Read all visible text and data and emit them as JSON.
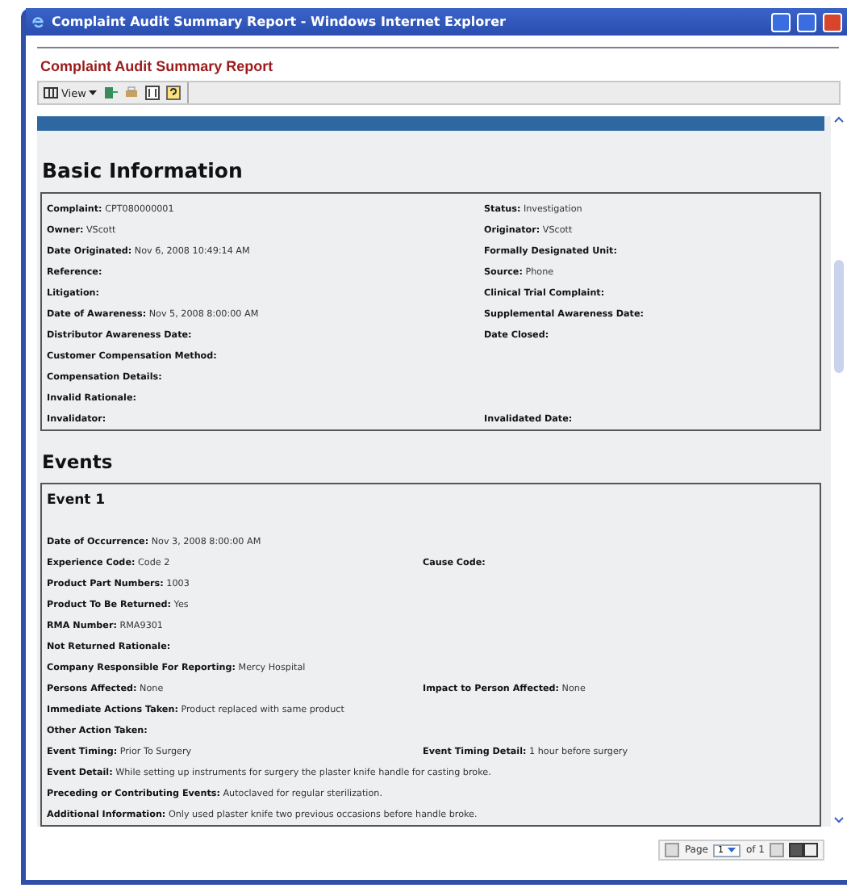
{
  "window": {
    "title": "Complaint Audit Summary Report - Windows Internet Explorer"
  },
  "report": {
    "title": "Complaint Audit Summary Report"
  },
  "toolbar": {
    "view_label": "View"
  },
  "basic": {
    "heading": "Basic Information",
    "rows": [
      {
        "left": {
          "label": "Complaint:",
          "value": "CPT080000001"
        },
        "right": {
          "label": "Status:",
          "value": "Investigation"
        }
      },
      {
        "left": {
          "label": "Owner:",
          "value": "VScott"
        },
        "right": {
          "label": "Originator:",
          "value": "VScott"
        }
      },
      {
        "left": {
          "label": "Date Originated:",
          "value": "Nov 6, 2008 10:49:14 AM"
        },
        "right": {
          "label": "Formally Designated Unit:"
        }
      },
      {
        "left": {
          "label": "Reference:"
        },
        "right": {
          "label": "Source:",
          "value": "Phone"
        }
      },
      {
        "left": {
          "label": "Litigation:"
        },
        "right": {
          "label": "Clinical Trial Complaint:"
        }
      },
      {
        "left": {
          "label": "Date of Awareness:",
          "value": "Nov 5, 2008 8:00:00 AM"
        },
        "right": {
          "label": "Supplemental Awareness Date:"
        }
      },
      {
        "left": {
          "label": "Distributor Awareness Date:"
        },
        "right": {
          "label": "Date Closed:"
        }
      },
      {
        "left": {
          "label": "Customer Compensation Method:"
        }
      },
      {
        "left": {
          "label": "Compensation Details:"
        }
      },
      {
        "left": {
          "label": "Invalid Rationale:"
        }
      },
      {
        "left": {
          "label": "Invalidator:"
        },
        "right": {
          "label": "Invalidated Date:"
        }
      }
    ]
  },
  "events": {
    "heading": "Events",
    "items": [
      {
        "title": "Event 1",
        "rows": [
          {
            "left": {
              "label": "Date of Occurrence:",
              "value": "Nov 3, 2008 8:00:00 AM"
            }
          },
          {
            "left": {
              "label": "Experience Code:",
              "value": "Code 2"
            },
            "right": {
              "label": "Cause Code:"
            }
          },
          {
            "left": {
              "label": "Product Part Numbers:",
              "value": "1003"
            }
          },
          {
            "left": {
              "label": "Product To Be Returned:",
              "value": "Yes"
            }
          },
          {
            "left": {
              "label": "RMA Number:",
              "value": "RMA9301"
            }
          },
          {
            "left": {
              "label": "Not Returned Rationale:"
            }
          },
          {
            "left": {
              "label": "Company Responsible For Reporting:",
              "value": "Mercy Hospital"
            }
          },
          {
            "left": {
              "label": "Persons Affected:",
              "value": "None"
            },
            "right": {
              "label": "Impact to Person Affected:",
              "value": "None"
            }
          },
          {
            "left": {
              "label": "Immediate Actions Taken:",
              "value": "Product replaced with same product"
            }
          },
          {
            "left": {
              "label": "Other Action Taken:"
            }
          },
          {
            "left": {
              "label": "Event Timing:",
              "value": "Prior To Surgery"
            },
            "right": {
              "label": "Event Timing Detail:",
              "value": "1 hour before surgery"
            }
          },
          {
            "left": {
              "label": "Event Detail:",
              "value": "While setting up instruments for surgery the plaster knife handle for casting broke."
            }
          },
          {
            "left": {
              "label": "Preceding or Contributing Events:",
              "value": "Autoclaved for regular sterilization."
            }
          },
          {
            "left": {
              "label": "Additional Information:",
              "value": "Only used plaster knife two previous occasions before handle broke."
            }
          }
        ]
      }
    ]
  },
  "pager": {
    "page_label": "Page",
    "page_value": "1",
    "of_label": "of 1"
  }
}
